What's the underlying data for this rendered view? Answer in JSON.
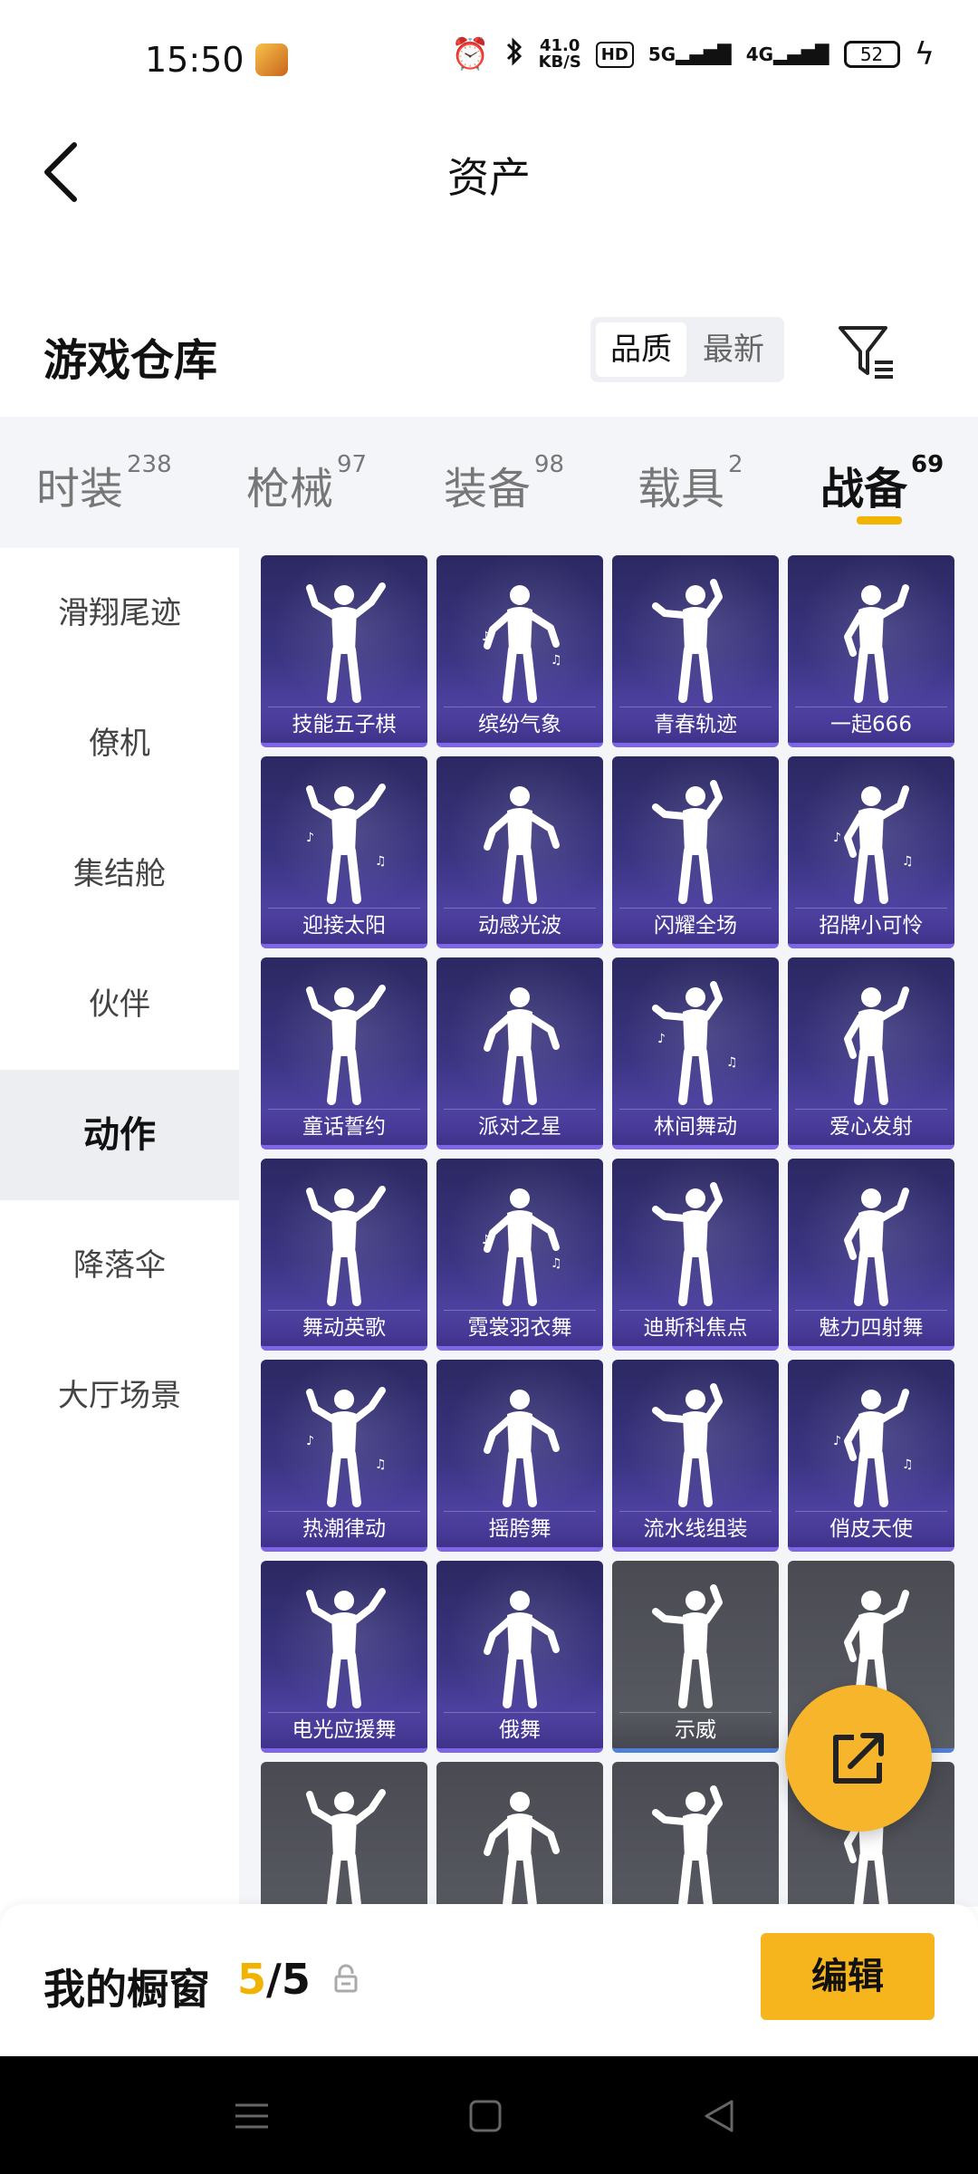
{
  "status_bar": {
    "time": "15:50",
    "net_speed_value": "41.0",
    "net_speed_unit": "KB/S",
    "hd_label": "HD",
    "net_5g": "5G",
    "net_4g": "4G",
    "battery": "52",
    "icons": [
      "app-icon",
      "alarm-icon",
      "bluetooth-icon",
      "hd-icon",
      "signal-5g-icon",
      "signal-4g-icon",
      "battery-icon",
      "charging-icon"
    ]
  },
  "header": {
    "title": "资产"
  },
  "inventory": {
    "title": "游戏仓库",
    "sort_options": [
      "品质",
      "最新"
    ],
    "sort_selected": "品质"
  },
  "tabs": [
    {
      "label": "时装",
      "count": "238",
      "active": false
    },
    {
      "label": "枪械",
      "count": "97",
      "active": false
    },
    {
      "label": "装备",
      "count": "98",
      "active": false
    },
    {
      "label": "载具",
      "count": "2",
      "active": false
    },
    {
      "label": "战备",
      "count": "69",
      "active": true
    }
  ],
  "sidebar": {
    "items": [
      {
        "label": "滑翔尾迹",
        "active": false
      },
      {
        "label": "僚机",
        "active": false
      },
      {
        "label": "集结舱",
        "active": false
      },
      {
        "label": "伙伴",
        "active": false
      },
      {
        "label": "动作",
        "active": true
      },
      {
        "label": "降落伞",
        "active": false
      },
      {
        "label": "大厅场景",
        "active": false
      }
    ]
  },
  "grid": {
    "items": [
      {
        "label": "技能五子棋",
        "tier": "purple"
      },
      {
        "label": "缤纷气象",
        "tier": "purple"
      },
      {
        "label": "青春轨迹",
        "tier": "purple"
      },
      {
        "label": "一起666",
        "tier": "purple"
      },
      {
        "label": "迎接太阳",
        "tier": "purple"
      },
      {
        "label": "动感光波",
        "tier": "purple"
      },
      {
        "label": "闪耀全场",
        "tier": "purple"
      },
      {
        "label": "招牌小可怜",
        "tier": "purple"
      },
      {
        "label": "童话誓约",
        "tier": "purple"
      },
      {
        "label": "派对之星",
        "tier": "purple"
      },
      {
        "label": "林间舞动",
        "tier": "purple"
      },
      {
        "label": "爱心发射",
        "tier": "purple"
      },
      {
        "label": "舞动英歌",
        "tier": "purple"
      },
      {
        "label": "霓裳羽衣舞",
        "tier": "purple"
      },
      {
        "label": "迪斯科焦点",
        "tier": "purple"
      },
      {
        "label": "魅力四射舞",
        "tier": "purple"
      },
      {
        "label": "热潮律动",
        "tier": "purple"
      },
      {
        "label": "摇胯舞",
        "tier": "purple"
      },
      {
        "label": "流水线组装",
        "tier": "purple"
      },
      {
        "label": "俏皮天使",
        "tier": "purple"
      },
      {
        "label": "电光应援舞",
        "tier": "purple"
      },
      {
        "label": "俄舞",
        "tier": "purple"
      },
      {
        "label": "示威",
        "tier": "gray"
      },
      {
        "label": "",
        "tier": "gray"
      },
      {
        "label": "",
        "tier": "gray"
      },
      {
        "label": "",
        "tier": "gray"
      },
      {
        "label": "",
        "tier": "gray"
      },
      {
        "label": "",
        "tier": "gray"
      }
    ]
  },
  "showcase": {
    "label": "我的橱窗",
    "current": "5",
    "separator": "/",
    "total": "5",
    "edit_label": "编辑"
  },
  "colors": {
    "accent": "#f6b51c",
    "purple_tier": "#5b4ab6",
    "gray_tier": "#5a5c64"
  }
}
